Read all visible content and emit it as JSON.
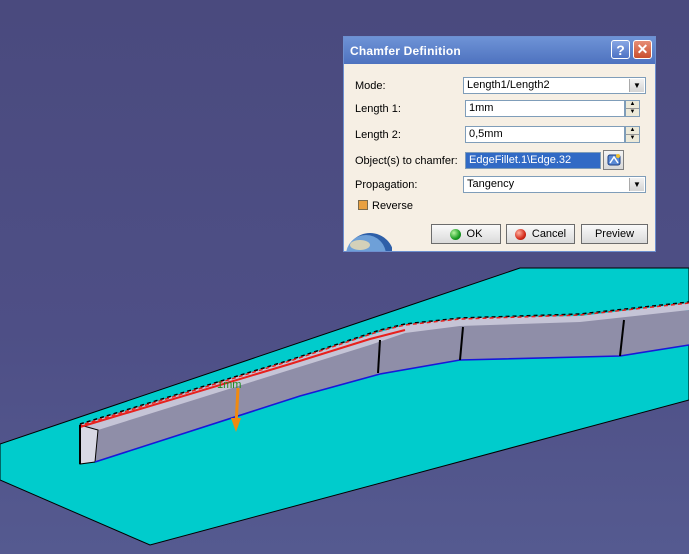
{
  "dialog": {
    "title": "Chamfer Definition",
    "help_icon": "question-icon",
    "close_icon": "close-icon",
    "mode": {
      "label": "Mode:",
      "value": "Length1/Length2"
    },
    "length1": {
      "label": "Length 1:",
      "value": "1mm"
    },
    "length2": {
      "label": "Length 2:",
      "value": "0,5mm"
    },
    "objects": {
      "label": "Object(s) to chamfer:",
      "value": "EdgeFillet.1\\Edge.32"
    },
    "propagation": {
      "label": "Propagation:",
      "value": "Tangency"
    },
    "reverse": {
      "label": "Reverse",
      "checked": false
    },
    "buttons": {
      "ok": "OK",
      "cancel": "Cancel",
      "preview": "Preview"
    }
  },
  "viewport": {
    "annotation": "1mm",
    "colors": {
      "background": "#4e4f86",
      "base_plate": "#00cccc",
      "part": "#c5c4d6",
      "selected_edge": "#e8201c",
      "edge_blue": "#1818d8",
      "arrow": "#f08a10"
    }
  }
}
